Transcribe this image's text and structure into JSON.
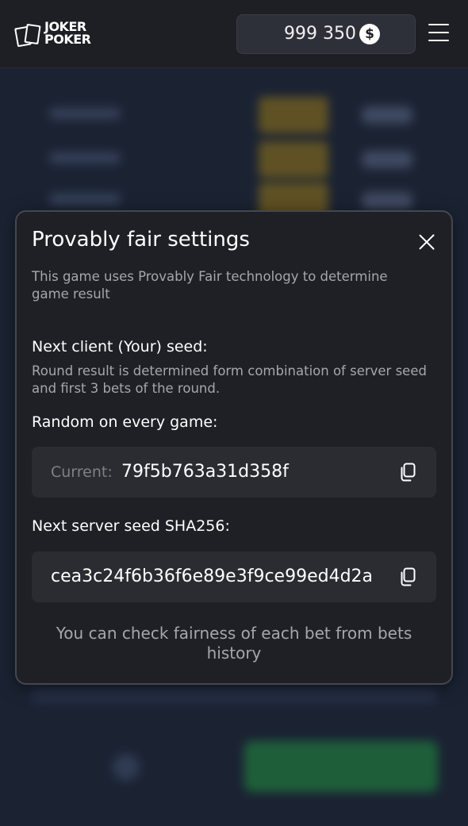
{
  "header": {
    "logo_line1": "JOKER",
    "logo_line2": "POKER",
    "balance": "999 350",
    "currency_symbol": "$"
  },
  "modal": {
    "title": "Provably fair settings",
    "intro": "This game uses Provably Fair technology to determine game result",
    "client_seed": {
      "title": "Next client (Your) seed:",
      "description": "Round result is determined form combination of server seed and first 3 bets of the round."
    },
    "random": {
      "title": "Random on every game:",
      "current_prefix": "Current:",
      "current_value": "79f5b763a31d358f"
    },
    "server_seed": {
      "title": "Next server seed SHA256:",
      "value": "cea3c24f6b36f6e89e3f9ce99ed4d2a"
    },
    "footer_note": "You can check fairness of each bet from bets history"
  },
  "colors": {
    "header_bg": "#1e1f24",
    "page_bg": "#1b2333",
    "modal_bg": "#1f2026",
    "field_bg": "#2b2c32",
    "muted_text": "#a5a7ad"
  }
}
